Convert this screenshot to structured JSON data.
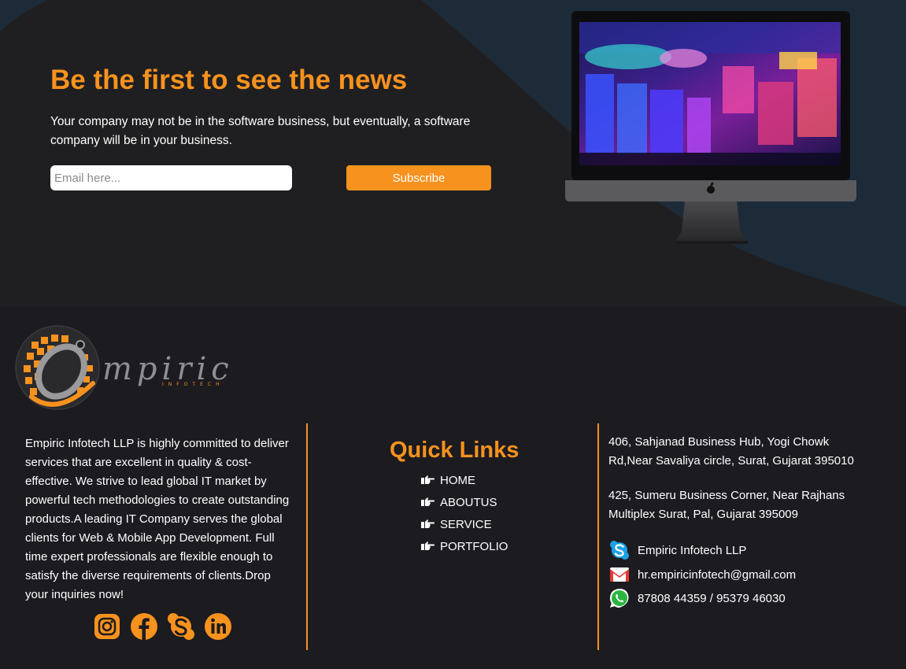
{
  "newsletter": {
    "title": "Be the first to see the news",
    "description": "Your company may not be in the software business, but eventually, a software company will be in your business.",
    "email_placeholder": "Email here...",
    "subscribe_label": "Subscribe"
  },
  "brand": {
    "logo_text": "mpiric",
    "logo_subtext": "INFOTECH"
  },
  "about": {
    "text": "Empiric Infotech LLP is highly committed to deliver services that are excellent in quality & cost-effective. We strive to lead global IT market by powerful tech methodologies to create outstanding products.A leading IT Company serves the global clients for Web & Mobile App Development. Full time expert professionals are flexible enough to satisfy the diverse requirements of clients.Drop your inquiries now!",
    "social": [
      {
        "icon": "instagram-icon"
      },
      {
        "icon": "facebook-icon"
      },
      {
        "icon": "skype-icon"
      },
      {
        "icon": "linkedin-icon"
      }
    ]
  },
  "quick_links": {
    "title": "Quick Links",
    "items": [
      {
        "label": "HOME"
      },
      {
        "label": "ABOUTUS"
      },
      {
        "label": "SERVICE"
      },
      {
        "label": "PORTFOLIO"
      }
    ]
  },
  "contact": {
    "address_1": "406, Sahjanad Business Hub, Yogi Chowk Rd,Near Savaliya circle, Surat, Gujarat 395010",
    "address_2": "425, Sumeru Business Corner, Near Rajhans Multiplex Surat, Pal, Gujarat 395009",
    "skype": "Empiric Infotech LLP",
    "email": "hr.empiricinfotech@gmail.com",
    "phone": "87808 44359 / 95379 46030"
  },
  "colors": {
    "accent": "#f7921e",
    "hero_bg": "#1f1f21",
    "hero_wave": "#1d2b38",
    "footer_bg": "#1c1b20",
    "text": "#ffffff"
  }
}
